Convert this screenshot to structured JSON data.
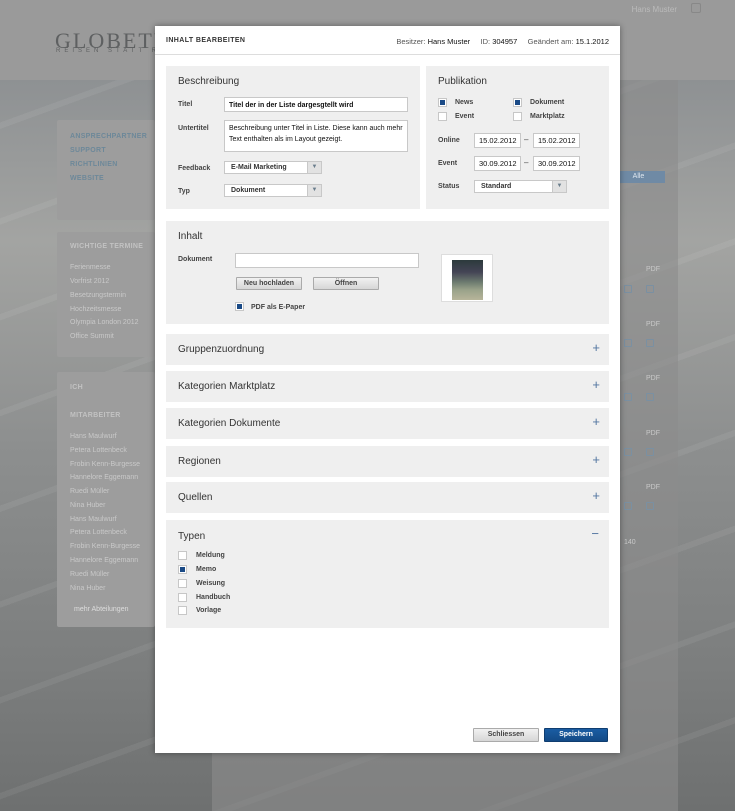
{
  "background": {
    "logo": "GLOBETROT",
    "tagline": "REISEN STATT R",
    "user": "Hans Muster",
    "nav_links": [
      "ANSPRECHPARTNER",
      "SUPPORT",
      "RICHTLINIEN",
      "WEBSITE"
    ],
    "termine_head": "WICHTIGE TERMINE",
    "termine": [
      "Ferienmesse",
      "Vorfrist 2012",
      "Besetzungstermin",
      "Hochzeitsmesse",
      "Olympia London 2012",
      "Office Summit"
    ],
    "ich_label": "ICH",
    "mitarbeiter_head": "MITARBEITER",
    "mitarbeiter": [
      "Hans Maulwurf",
      "Petera Lottenbeck",
      "Frobin Kenn-Burgesse",
      "Hannelore Eggemann",
      "Ruedi Müller",
      "Nina Huber",
      "Hans Maulwurf",
      "Petera Lottenbeck",
      "Frobin Kenn-Burgesse",
      "Hannelore Eggemann",
      "Ruedi Müller",
      "Nina Huber"
    ],
    "more_btn": "mehr Abteilungen",
    "filter_btn": "Alle",
    "pdf": "PDF",
    "pager": "140"
  },
  "modal": {
    "title": "INHALT BEARBEITEN",
    "owner_label": "Besitzer:",
    "owner": "Hans Muster",
    "id_label": "ID:",
    "id": "304957",
    "changed_label": "Geändert am:",
    "changed": "15.1.2012",
    "beschreibung": {
      "title": "Beschreibung",
      "titel_label": "Titel",
      "titel_value": "Titel der in der Liste dargesgtellt wird",
      "untertitel_label": "Untertitel",
      "untertitel_value": "Beschreibung unter Titel in Liste. Diese kann auch mehr Text enthalten als im Layout gezeigt.",
      "feedback_label": "Feedback",
      "feedback_value": "E-Mail Marketing",
      "typ_label": "Typ",
      "typ_value": "Dokument"
    },
    "publikation": {
      "title": "Publikation",
      "news": "News",
      "dokument": "Dokument",
      "event_cb": "Event",
      "marktplatz": "Marktplatz",
      "news_checked": true,
      "dokument_checked": true,
      "event_checked": false,
      "marktplatz_checked": false,
      "online_label": "Online",
      "online_from": "15.02.2012",
      "online_to": "15.02.2012",
      "event_label": "Event",
      "event_from": "30.09.2012",
      "event_to": "30.09.2012",
      "dash": "–",
      "status_label": "Status",
      "status_value": "Standard"
    },
    "inhalt": {
      "title": "Inhalt",
      "dokument_label": "Dokument",
      "dokument_value": "",
      "upload_btn": "Neu hochladen",
      "open_btn": "Öffnen",
      "epaper_label": "PDF als E-Paper",
      "epaper_checked": true
    },
    "sections": [
      {
        "title": "Gruppenzuordnung",
        "toggle": "+"
      },
      {
        "title": "Kategorien Marktplatz",
        "toggle": "+"
      },
      {
        "title": "Kategorien Dokumente",
        "toggle": "+"
      },
      {
        "title": "Regionen",
        "toggle": "+"
      },
      {
        "title": "Quellen",
        "toggle": "+"
      }
    ],
    "typen": {
      "title": "Typen",
      "toggle": "−",
      "items": [
        {
          "label": "Meldung",
          "checked": false
        },
        {
          "label": "Memo",
          "checked": true
        },
        {
          "label": "Weisung",
          "checked": false
        },
        {
          "label": "Handbuch",
          "checked": false
        },
        {
          "label": "Vorlage",
          "checked": false
        }
      ]
    },
    "close_btn": "Schliessen",
    "save_btn": "Speichern"
  }
}
